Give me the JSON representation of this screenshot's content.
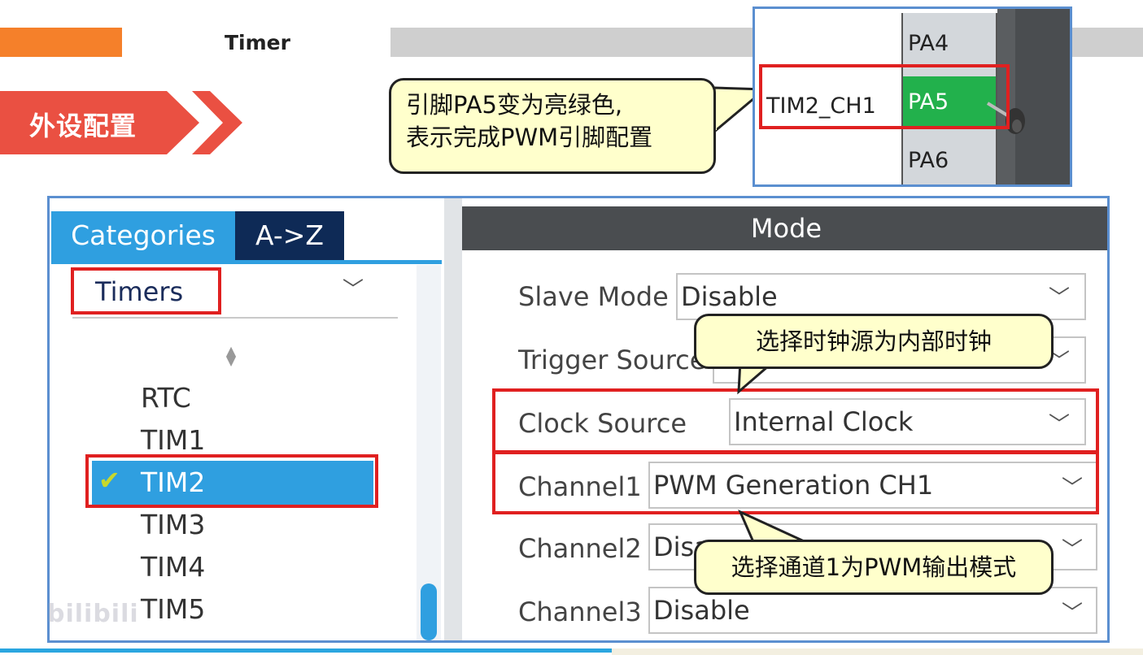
{
  "header": {
    "title": "Timer",
    "section_tag": "外设配置"
  },
  "pin_inset": {
    "signal_label": "TIM2_CH1",
    "pins": [
      "PA4",
      "PA5",
      "PA6"
    ],
    "active_pin_color": "#22b14c"
  },
  "callouts": {
    "pin": [
      "引脚PA5变为亮绿色,",
      "表示完成PWM引脚配置"
    ],
    "clock": "选择时钟源为内部时钟",
    "channel": "选择通道1为PWM输出模式"
  },
  "left_pane": {
    "tabs": {
      "categories": "Categories",
      "az": "A->Z"
    },
    "category": "Timers",
    "tree_items": [
      "RTC",
      "TIM1",
      "TIM2",
      "TIM3",
      "TIM4",
      "TIM5"
    ],
    "selected_item": "TIM2"
  },
  "mode_panel": {
    "header": "Mode",
    "fields": [
      {
        "label": "Slave Mode",
        "value": "Disable"
      },
      {
        "label": "Trigger Source",
        "value": ""
      },
      {
        "label": "Clock Source",
        "value": "Internal Clock"
      },
      {
        "label": "Channel1",
        "value": "PWM Generation CH1"
      },
      {
        "label": "Channel2",
        "value": "Disa"
      },
      {
        "label": "Channel3",
        "value": "Disable"
      }
    ]
  },
  "watermark": "bilibili",
  "colors": {
    "accent_blue": "#2f9fe0",
    "highlight_red": "#e02020",
    "callout_fill": "#ffffcc",
    "orange": "#f5802a",
    "tag_red": "#ea5042"
  }
}
